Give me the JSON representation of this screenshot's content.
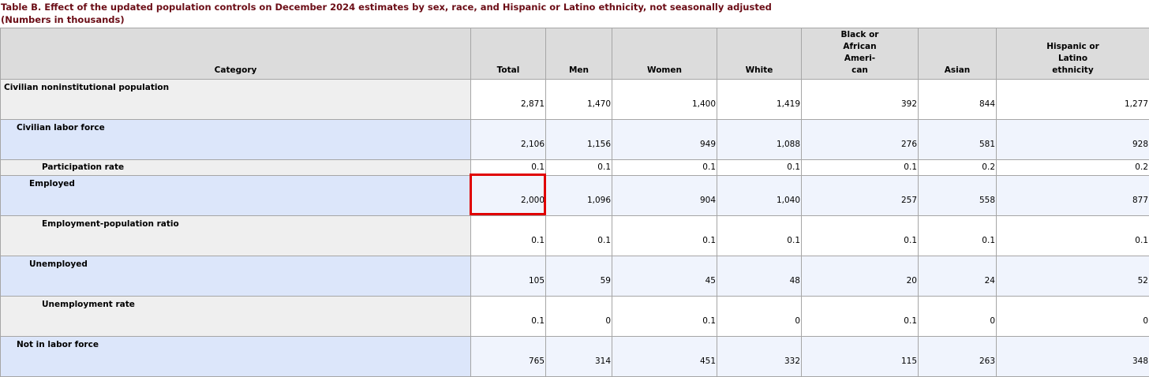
{
  "caption": {
    "title": "Table B. Effect of the updated population controls on December 2024 estimates by sex, race, and Hispanic or Latino ethnicity, not seasonally adjusted",
    "subtitle": "(Numbers in thousands)"
  },
  "columns": {
    "category": "Category",
    "total": "Total",
    "men": "Men",
    "women": "Women",
    "white": "White",
    "black": [
      "Black or",
      "African",
      "Ameri-",
      "can"
    ],
    "asian": "Asian",
    "hispanic": [
      "Hispanic or",
      "Latino",
      "ethnicity"
    ]
  },
  "rows": [
    {
      "label": "Civilian noninstitutional population",
      "values": [
        "2,871",
        "1,470",
        "1,400",
        "1,419",
        "392",
        "844",
        "1,277"
      ]
    },
    {
      "label": "Civilian labor force",
      "values": [
        "2,106",
        "1,156",
        "949",
        "1,088",
        "276",
        "581",
        "928"
      ]
    },
    {
      "label": "Participation rate",
      "values": [
        "0.1",
        "0.1",
        "0.1",
        "0.1",
        "0.1",
        "0.2",
        "0.2"
      ]
    },
    {
      "label": "Employed",
      "values": [
        "2,000",
        "1,096",
        "904",
        "1,040",
        "257",
        "558",
        "877"
      ]
    },
    {
      "label": "Employment-population ratio",
      "values": [
        "0.1",
        "0.1",
        "0.1",
        "0.1",
        "0.1",
        "0.1",
        "0.1"
      ]
    },
    {
      "label": "Unemployed",
      "values": [
        "105",
        "59",
        "45",
        "48",
        "20",
        "24",
        "52"
      ]
    },
    {
      "label": "Unemployment rate",
      "values": [
        "0.1",
        "0",
        "0.1",
        "0",
        "0.1",
        "0",
        "0"
      ]
    },
    {
      "label": "Not in labor force",
      "values": [
        "765",
        "314",
        "451",
        "332",
        "115",
        "263",
        "348"
      ]
    }
  ],
  "highlight": {
    "row": "Employed",
    "column": "Total",
    "color": "#e00000"
  },
  "colors": {
    "title": "#6b0d16",
    "header_bg": "#dcdcdc",
    "stub_gray": "#efefef",
    "stub_blue": "#dce6fa",
    "cell_blue": "#f0f4fd",
    "border": "#a6a6a6"
  }
}
